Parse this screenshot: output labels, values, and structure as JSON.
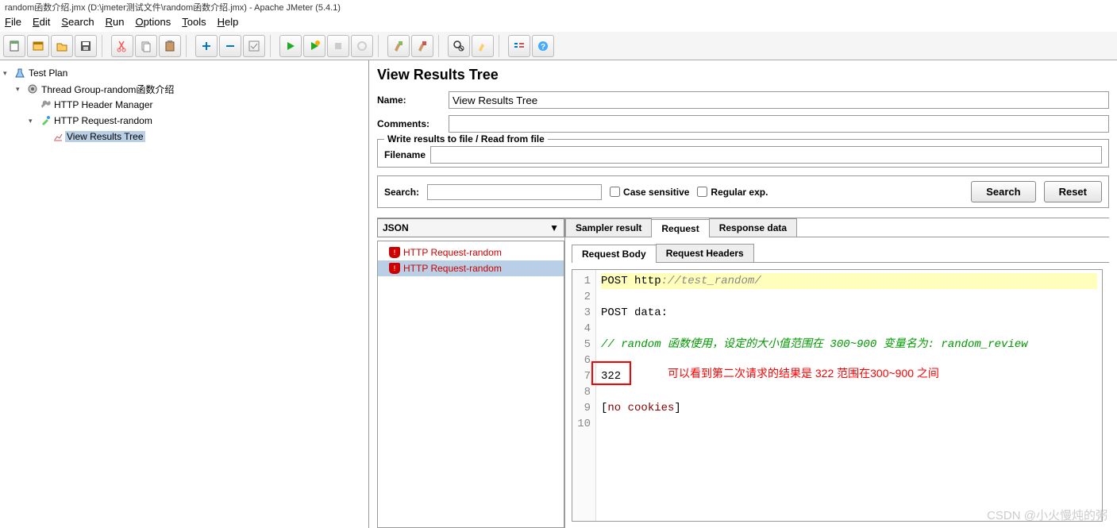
{
  "titlebar": "random函数介绍.jmx (D:\\jmeter测试文件\\random函数介绍.jmx) - Apache JMeter (5.4.1)",
  "menu": [
    "File",
    "Edit",
    "Search",
    "Run",
    "Options",
    "Tools",
    "Help"
  ],
  "menu_underline": [
    "F",
    "E",
    "S",
    "R",
    "O",
    "T",
    "H"
  ],
  "tree": {
    "root": "Test Plan",
    "group": "Thread Group-random函数介绍",
    "header_mgr": "HTTP Header Manager",
    "request": "HTTP Request-random",
    "listener": "View Results Tree"
  },
  "vrt": {
    "title": "View Results Tree",
    "name_label": "Name:",
    "name_value": "View Results Tree",
    "comments_label": "Comments:",
    "file_group": "Write results to file / Read from file",
    "filename_label": "Filename",
    "search_label": "Search:",
    "case_sensitive": "Case sensitive",
    "regex": "Regular exp.",
    "search_btn": "Search",
    "reset_btn": "Reset",
    "renderer": "JSON",
    "tabs": [
      "Sampler result",
      "Request",
      "Response data"
    ],
    "subtabs": [
      "Request Body",
      "Request Headers"
    ],
    "samplers": [
      "HTTP Request-random",
      "HTTP Request-random"
    ]
  },
  "code": {
    "lines": [
      "1",
      "2",
      "3",
      "4",
      "5",
      "6",
      "7",
      "8",
      "9",
      "10"
    ],
    "l1a": "POST http",
    "l1b": "://test_random/",
    "l3": "POST data:",
    "l5": "// random 函数使用，设定的大小值范围在 300~900 变量名为: random_review",
    "l7": "322",
    "l9a": "[",
    "l9b": "no cookies",
    "l9c": "]",
    "annotation": "可以看到第二次请求的结果是 322  范围在300~900 之间"
  },
  "watermark": "CSDN @小火慢炖的粥"
}
